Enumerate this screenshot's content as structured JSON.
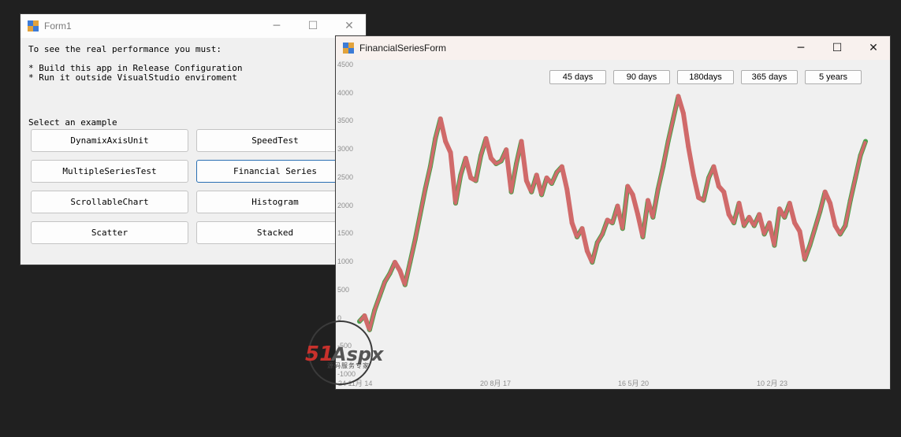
{
  "form1": {
    "title": "Form1",
    "line1": "To see the real performance you must:",
    "line2": "* Build this app in Release Configuration",
    "line3": "* Run it outside VisualStudio enviroment",
    "select_label": "Select an example",
    "buttons": [
      "DynamixAxisUnit",
      "SpeedTest",
      "MultipleSeriesTest",
      "Financial Series",
      "ScrollableChart",
      "Histogram",
      "Scatter",
      "Stacked"
    ]
  },
  "financial": {
    "title": "FinancialSeriesForm",
    "ranges": [
      "45 days",
      "90 days",
      "180days",
      "365 days",
      "5 years"
    ],
    "y_ticks": [
      "4500",
      "4000",
      "3500",
      "3000",
      "2500",
      "2000",
      "1500",
      "1000",
      "500",
      "0",
      "-500",
      "-1000"
    ],
    "x_ticks": [
      "24 11月 14",
      "20 8月 17",
      "16 5月 20",
      "10 2月 23"
    ]
  },
  "window_controls": {
    "minimize": "─",
    "maximize": "☐",
    "close": "✕"
  },
  "colors": {
    "up": "#4aa04a",
    "down": "#d06a6a",
    "plot_bg": "#f0f0f0",
    "desktop": "#202020"
  },
  "watermark": {
    "brand": "51Aspx",
    "subtitle": "源码服务专家"
  },
  "chart_data": {
    "type": "line",
    "title": "",
    "xlabel": "",
    "ylabel": "",
    "ylim": [
      -1000,
      4500
    ],
    "x_ticks": [
      "24 11月 14",
      "20 8月 17",
      "16 5月 20",
      "10 2月 23"
    ],
    "series": [
      {
        "values": [
          -50,
          50,
          -200,
          150,
          400,
          650,
          800,
          1000,
          850,
          600,
          1000,
          1400,
          1850,
          2300,
          2700,
          3200,
          3550,
          3150,
          2950,
          2050,
          2550,
          2850,
          2500,
          2450,
          2900,
          3200,
          2850,
          2750,
          2800,
          3000,
          2250,
          2750,
          3150,
          2450,
          2250,
          2550,
          2200,
          2500,
          2400,
          2600,
          2700,
          2300,
          1700,
          1450,
          1600,
          1200,
          1000,
          1350,
          1500,
          1750,
          1700,
          2000,
          1600,
          2350,
          2200,
          1850,
          1450,
          2100,
          1800,
          2300,
          2700,
          3150,
          3550,
          3950,
          3650,
          3050,
          2550,
          2150,
          2100,
          2500,
          2700,
          2350,
          2250,
          1850,
          1700,
          2050,
          1650,
          1800,
          1650,
          1850,
          1500,
          1700,
          1300,
          1950,
          1800,
          2050,
          1700,
          1550,
          1050,
          1300,
          1600,
          1900,
          2250,
          2050,
          1650,
          1500,
          1650,
          2100,
          2500,
          2900,
          3150
        ]
      }
    ]
  }
}
